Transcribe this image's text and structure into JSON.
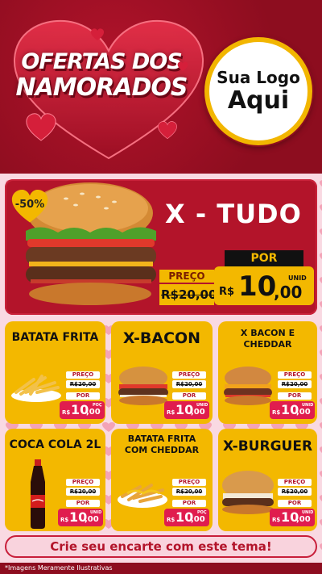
{
  "header": {
    "title_line1": "OFERTAS DOS",
    "title_line2": "NAMORADOS",
    "logo_line1": "Sua Logo",
    "logo_line2": "Aqui"
  },
  "hero": {
    "discount_badge": "-50%",
    "product_name": "X - TUDO",
    "preco_label": "PREÇO",
    "old_price": "R$20,00",
    "por_label": "POR",
    "currency": "R$",
    "price_int": "10",
    "price_dec": ",00",
    "unit": "UNID"
  },
  "cards": [
    {
      "name": "BATATA FRITA",
      "preco_label": "PREÇO",
      "old_price": "R$20,00",
      "por_label": "POR",
      "currency": "R$",
      "price_int": "10",
      "price_dec": ",00",
      "unit": "POÇ"
    },
    {
      "name": "X-BACON",
      "preco_label": "PREÇO",
      "old_price": "R$20,00",
      "por_label": "POR",
      "currency": "R$",
      "price_int": "10",
      "price_dec": ",00",
      "unit": "UNID"
    },
    {
      "name": "X BACON E CHEDDAR",
      "preco_label": "PREÇO",
      "old_price": "R$20,00",
      "por_label": "POR",
      "currency": "R$",
      "price_int": "10",
      "price_dec": ",00",
      "unit": "UNID"
    },
    {
      "name": "COCA COLA 2L",
      "preco_label": "PREÇO",
      "old_price": "R$20,00",
      "por_label": "POR",
      "currency": "R$",
      "price_int": "10",
      "price_dec": ",00",
      "unit": "UNID"
    },
    {
      "name": "BATATA FRITA COM CHEDDAR",
      "preco_label": "PREÇO",
      "old_price": "R$20,00",
      "por_label": "POR",
      "currency": "R$",
      "price_int": "10",
      "price_dec": ",00",
      "unit": "POÇ"
    },
    {
      "name": "X-BURGUER",
      "preco_label": "PREÇO",
      "old_price": "R$20,00",
      "por_label": "POR",
      "currency": "R$",
      "price_int": "10",
      "price_dec": ",00",
      "unit": "UNID"
    }
  ],
  "footer": {
    "cta": "Crie seu encarte com este tema!",
    "disclaimer": "*Imagens Meramente Ilustrativas"
  },
  "colors": {
    "brand_red": "#b3142a",
    "dark_red": "#8d0d1f",
    "yellow": "#f3b800",
    "pink": "#f9d9e2",
    "price_pink": "#e01d4e"
  },
  "icons": [
    "heart-icon",
    "burger-image",
    "fries-image",
    "soda-bottle-image",
    "cheddar-fries-image"
  ]
}
